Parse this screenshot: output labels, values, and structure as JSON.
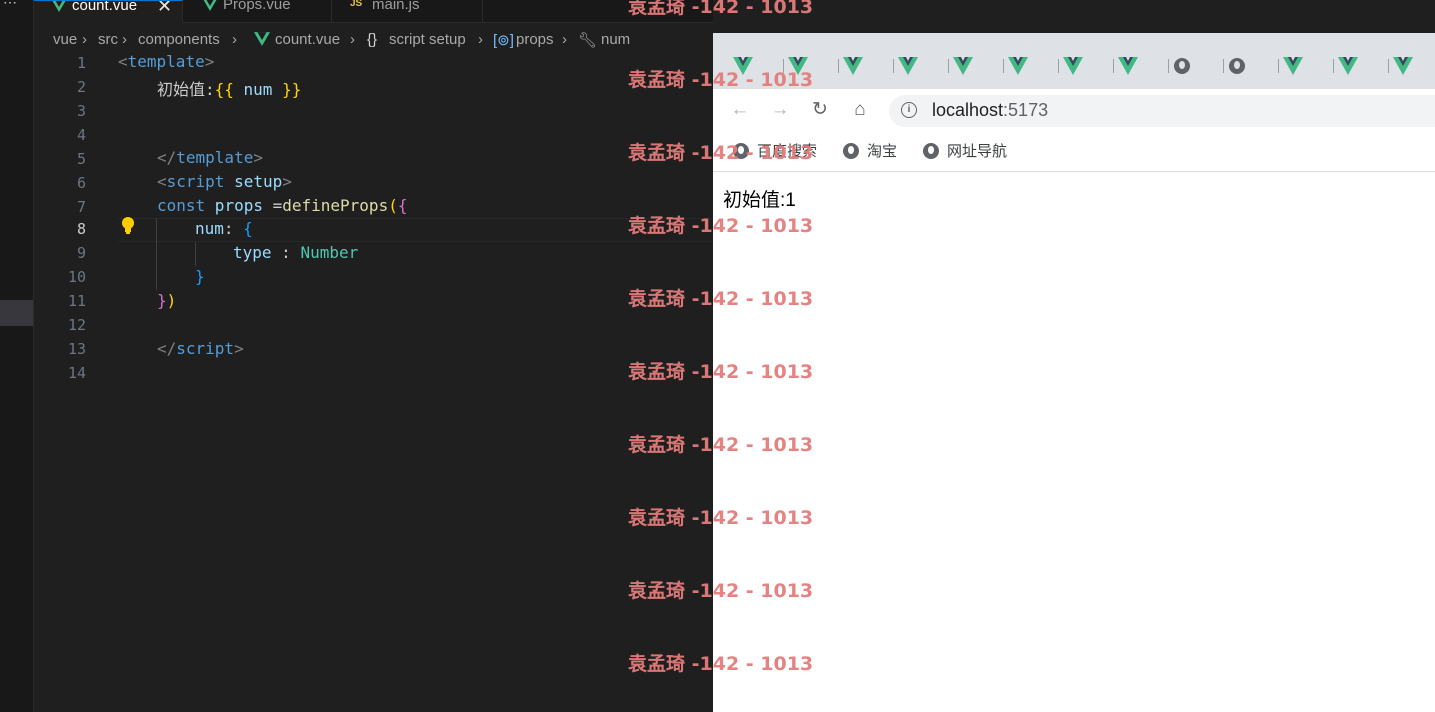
{
  "editor": {
    "tabs": [
      {
        "label": "count.vue",
        "icon": "vue-icon",
        "active": true
      },
      {
        "label": "Props.vue",
        "icon": "vue-icon",
        "active": false
      },
      {
        "label": "main.js",
        "icon": "js-icon",
        "active": false,
        "icon_text": "JS"
      }
    ],
    "breadcrumb": [
      "vue",
      "src",
      "components",
      "count.vue",
      "script setup",
      "props",
      "num"
    ],
    "line_numbers": [
      "1",
      "2",
      "3",
      "4",
      "5",
      "6",
      "7",
      "8",
      "9",
      "10",
      "11",
      "12",
      "13",
      "14"
    ],
    "current_line": "8",
    "code": {
      "l1_open": "<",
      "l1_tag": "template",
      "l1_close": ">",
      "l2_text": "初始值:",
      "l2_open": "{{",
      "l2_var": " num ",
      "l2_close": "}}",
      "l5_open": "</",
      "l5_tag": "template",
      "l5_close": ">",
      "l6_open": "<",
      "l6_tag": "script",
      "l6_attr": " setup",
      "l6_close": ">",
      "l7_kw": "const",
      "l7_var": " props",
      "l7_eq": " =",
      "l7_fn": "defineProps",
      "l7_paren": "(",
      "l7_brace": "{",
      "l8_key": "num",
      "l8_colon": ": ",
      "l8_brace": "{",
      "l9_key": "type",
      "l9_colon": " : ",
      "l9_type": "Number",
      "l10_brace": "}",
      "l11_brace": "}",
      "l11_paren": ")",
      "l13_open": "</",
      "l13_tag": "script",
      "l13_close": ">"
    }
  },
  "browser": {
    "url_host": "localhost",
    "url_port": ":5173",
    "bookmarks": [
      "百度搜索",
      "淘宝",
      "网址导航"
    ],
    "page_text": "初始值:1"
  },
  "watermark": "袁孟琦 -142 - 1013",
  "colors": {
    "vue_green": "#42b883",
    "vue_dark": "#35495e",
    "accent": "#0078d4"
  }
}
